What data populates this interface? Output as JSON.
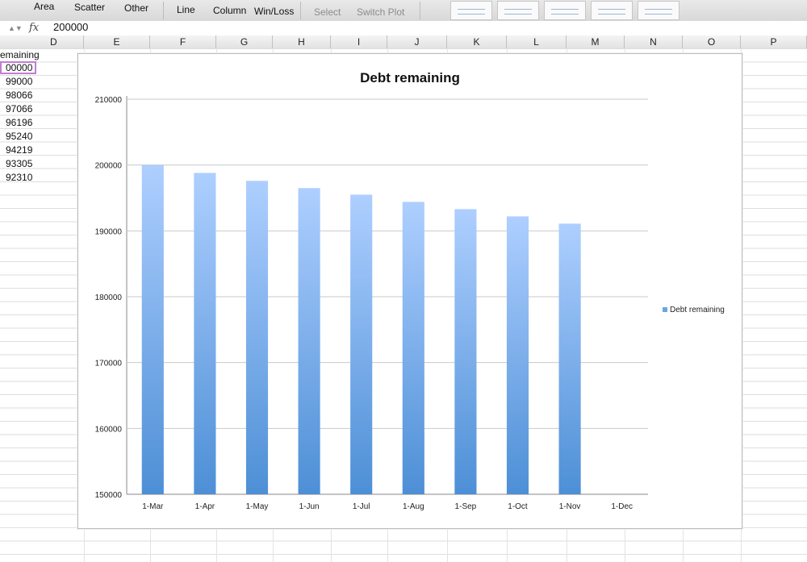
{
  "ribbon": {
    "chart_types": [
      "Area",
      "Scatter",
      "Other",
      "Line",
      "Column",
      "Win/Loss"
    ],
    "data_actions": [
      "Select",
      "Switch Plot"
    ]
  },
  "formula_bar": {
    "fx_label": "fx",
    "value": "200000"
  },
  "columns": [
    "D",
    "E",
    "F",
    "G",
    "H",
    "I",
    "J",
    "K",
    "L",
    "M",
    "N",
    "O",
    "P"
  ],
  "sheet": {
    "header_cell": "emaining",
    "cells": [
      "00000",
      "99000",
      "98066",
      "97066",
      "96196",
      "95240",
      "94219",
      "93305",
      "92310"
    ]
  },
  "chart_data": {
    "type": "bar",
    "title": "Debt remaining",
    "categories": [
      "1-Mar",
      "1-Apr",
      "1-May",
      "1-Jun",
      "1-Jul",
      "1-Aug",
      "1-Sep",
      "1-Oct",
      "1-Nov",
      "1-Dec"
    ],
    "series": [
      {
        "name": "Debt remaining",
        "values": [
          200000,
          198800,
          197600,
          196500,
          195500,
          194400,
          193300,
          192200,
          191100,
          null
        ]
      }
    ],
    "y_ticks": [
      150000,
      160000,
      170000,
      180000,
      190000,
      200000,
      210000
    ],
    "ylim": [
      150000,
      210000
    ],
    "legend_position": "right",
    "grid": true,
    "bar_gradient": [
      "#aecfff",
      "#4d8fd6"
    ]
  }
}
